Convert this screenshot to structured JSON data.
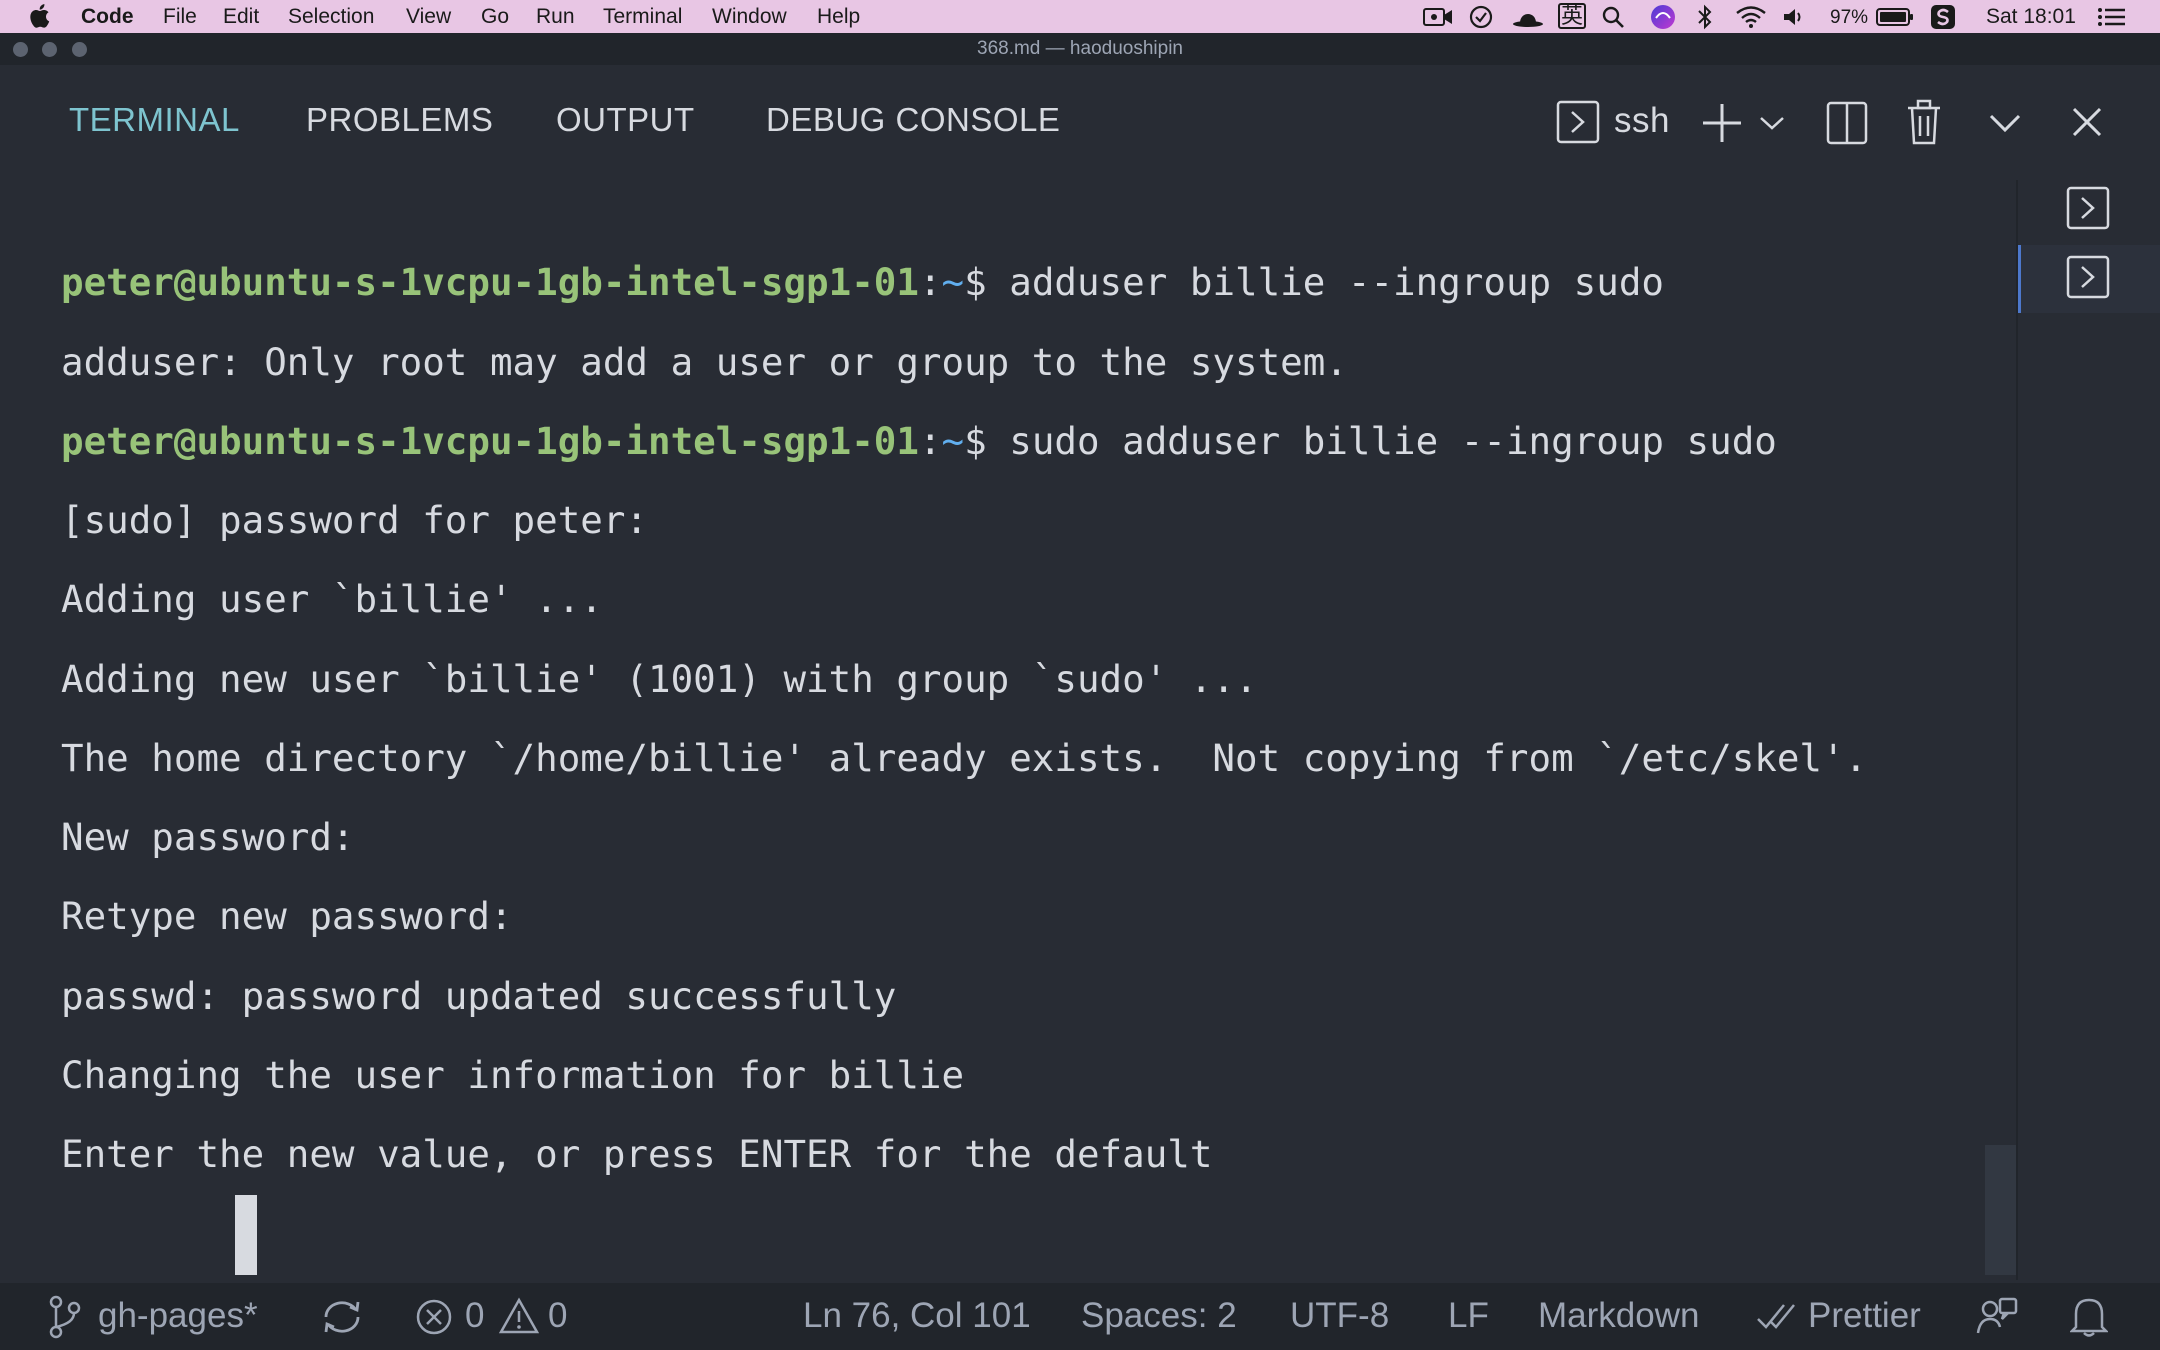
{
  "menubar": {
    "app_name": "Code",
    "items": [
      "File",
      "Edit",
      "Selection",
      "View",
      "Go",
      "Run",
      "Terminal",
      "Window",
      "Help"
    ],
    "battery": "97%",
    "clock": "Sat 18:01",
    "ime": "英",
    "icons": [
      "apple-logo",
      "screen-record-icon",
      "sync-app-icon",
      "hat-icon",
      "input-method-icon",
      "search-icon",
      "siri-icon",
      "bluetooth-icon",
      "wifi-icon",
      "volume-icon",
      "battery-icon",
      "app-s-icon",
      "list-icon"
    ]
  },
  "window": {
    "title": "368.md — haoduoshipin"
  },
  "panel": {
    "tabs": [
      "TERMINAL",
      "PROBLEMS",
      "OUTPUT",
      "DEBUG CONSOLE"
    ],
    "active_tab": "TERMINAL",
    "terminal_name": "ssh"
  },
  "terminal": {
    "prompt_user": "peter@ubuntu-s-1vcpu-1gb-intel-sgp1-01",
    "prompt_sep": ":",
    "prompt_path": "~",
    "prompt_symbol": "$",
    "cmd1": " adduser billie --ingroup sudo",
    "out1": "adduser: Only root may add a user or group to the system.",
    "cmd2": " sudo adduser billie --ingroup sudo",
    "out2": "[sudo] password for peter:",
    "out3": "Adding user `billie' ...",
    "out4": "Adding new user `billie' (1001) with group `sudo' ...",
    "out5": "The home directory `/home/billie' already exists.  Not copying from `/etc/skel'.",
    "out6": "New password:",
    "out7": "Retype new password:",
    "out8": "passwd: password updated successfully",
    "out9": "Changing the user information for billie",
    "out10": "Enter the new value, or press ENTER for the default"
  },
  "statusbar": {
    "branch": "gh-pages*",
    "errors": "0",
    "warnings": "0",
    "position": "Ln 76, Col 101",
    "spaces": "Spaces: 2",
    "encoding": "UTF-8",
    "eol": "LF",
    "language": "Markdown",
    "formatter": "Prettier"
  }
}
